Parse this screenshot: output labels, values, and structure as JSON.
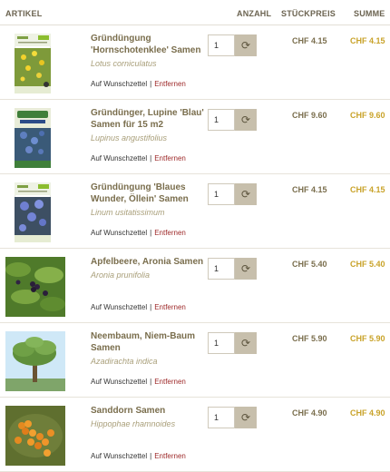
{
  "header": {
    "artikel": "ARTIKEL",
    "anzahl": "ANZAHL",
    "stueckpreis": "STÜCKPREIS",
    "summe": "SUMME"
  },
  "links": {
    "wishlist": "Auf Wunschzettel",
    "separator": "|",
    "remove": "Entfernen"
  },
  "refresh_icon": "refresh-icon",
  "items": [
    {
      "title": "Gründüngung 'Hornschotenklee' Samen",
      "latin": "Lotus corniculatus",
      "qty": "1",
      "price": "CHF 4.15",
      "sum": "CHF 4.15",
      "image": "seed-packet"
    },
    {
      "title": "Gründünger, Lupine 'Blau' Samen für 15 m2",
      "latin": "Lupinus angustifolius",
      "qty": "1",
      "price": "CHF 9.60",
      "sum": "CHF 9.60",
      "image": "seed-box"
    },
    {
      "title": "Gründüngung 'Blaues Wunder, Öllein' Samen",
      "latin": "Linum usitatissimum",
      "qty": "1",
      "price": "CHF 4.15",
      "sum": "CHF 4.15",
      "image": "seed-packet"
    },
    {
      "title": "Apfelbeere, Aronia Samen",
      "latin": "Aronia prunifolia",
      "qty": "1",
      "price": "CHF 5.40",
      "sum": "CHF 5.40",
      "image": "aronia-photo"
    },
    {
      "title": "Neembaum, Niem-Baum Samen",
      "latin": "Azadirachta indica",
      "qty": "1",
      "price": "CHF 5.90",
      "sum": "CHF 5.90",
      "image": "tree-photo"
    },
    {
      "title": "Sanddorn Samen",
      "latin": "Hippophae rhamnoides",
      "qty": "1",
      "price": "CHF 4.90",
      "sum": "CHF 4.90",
      "image": "berries-photo"
    }
  ]
}
